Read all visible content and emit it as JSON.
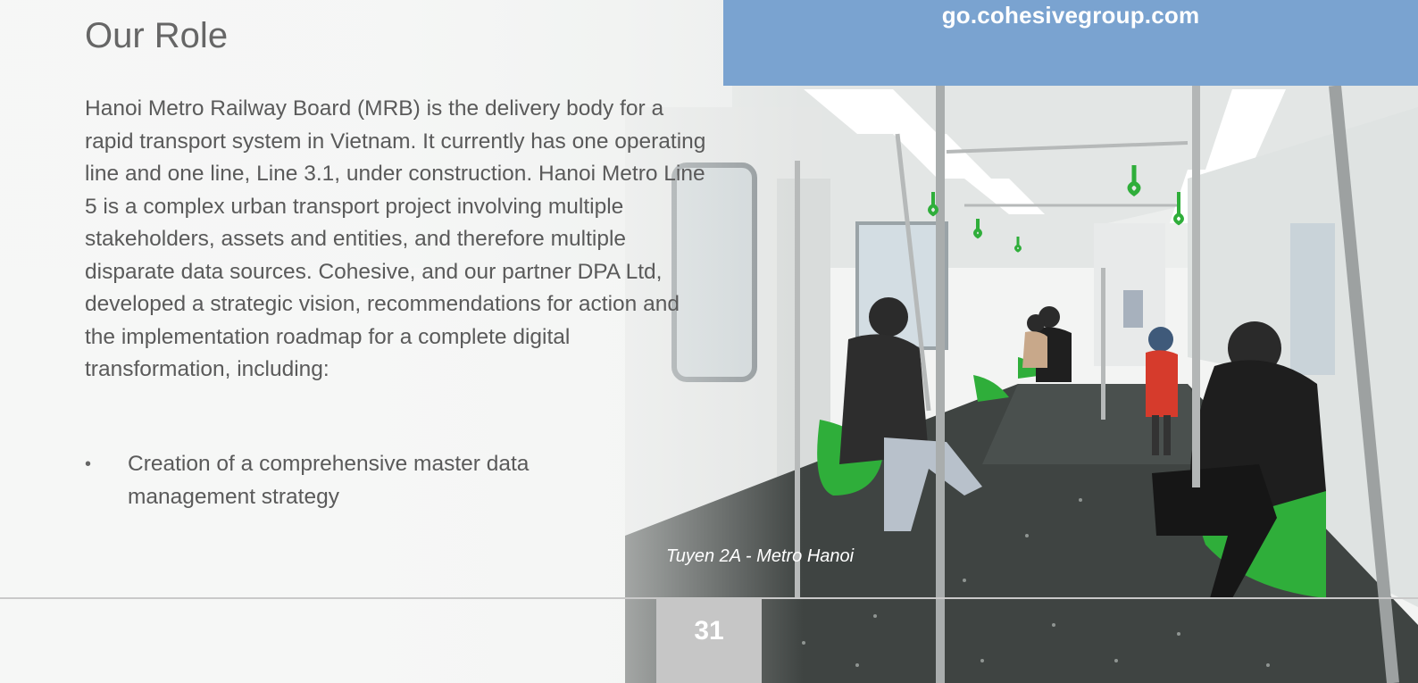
{
  "header": {
    "url": "go.cohesivegroup.com"
  },
  "slide": {
    "title": "Our Role",
    "body": "Hanoi Metro Railway Board (MRB) is the delivery body for a rapid transport system in Vietnam. It currently has one operating line and one line, Line 3.1, under construction. Hanoi Metro Line 5 is a complex urban transport project involving multiple stakeholders, assets and entities, and therefore multiple disparate data sources. Cohesive, and our partner DPA Ltd, developed a strategic vision, recommendations for action and the implementation roadmap for a complete digital transformation, including:",
    "bullets": [
      {
        "marker": "•",
        "text": "Creation of a comprehensive master data management strategy"
      }
    ],
    "photo_caption": "Tuyen 2A - Metro Hanoi",
    "page_number": "31"
  },
  "colors": {
    "banner": "#7aa3d0",
    "seat_green": "#2fae3a",
    "text": "#5a5a5a",
    "page_box": "#c6c6c6"
  }
}
